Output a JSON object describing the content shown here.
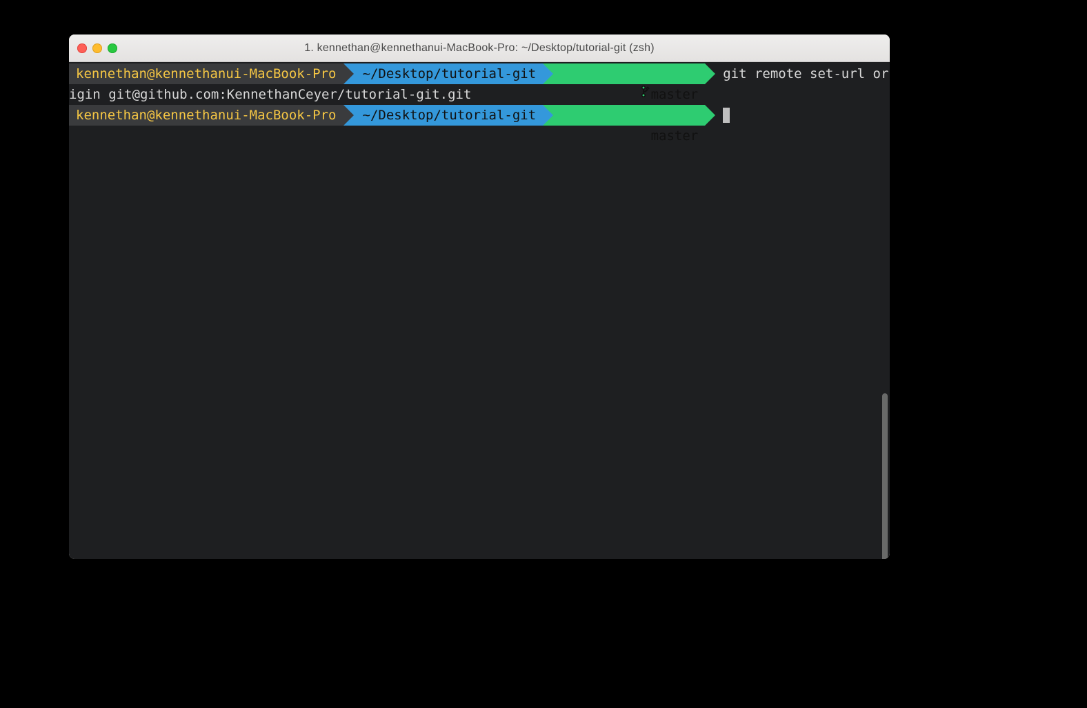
{
  "window": {
    "title": "1. kennethan@kennethanui-MacBook-Pro: ~/Desktop/tutorial-git (zsh)"
  },
  "prompt": {
    "user_host": "kennethan@kennethanui-MacBook-Pro",
    "path": "~/Desktop/tutorial-git",
    "branch": "master"
  },
  "history": {
    "command_visible_part": "git remote set-url or",
    "command_wrapped_part": "igin git@github.com:KennethanCeyer/tutorial-git.git"
  },
  "colors": {
    "bg": "#1e1f21",
    "userhost_fg": "#f6c744",
    "path_bg": "#3498db",
    "branch_bg": "#2ecc71"
  }
}
